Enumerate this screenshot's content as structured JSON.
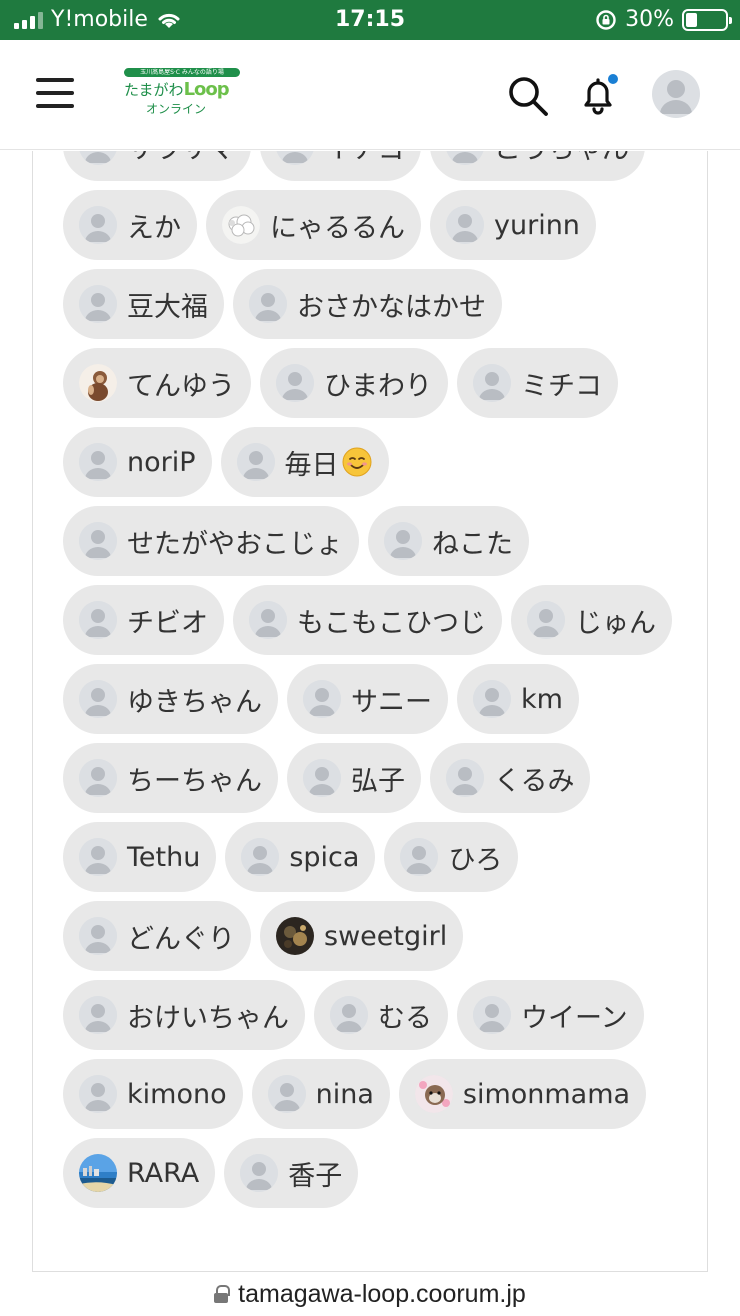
{
  "status_bar": {
    "carrier": "Y!mobile",
    "time": "17:15",
    "battery": "30%",
    "battery_level": 0.3
  },
  "header": {
    "logo": {
      "band": "玉川髙島屋S·C みんなの語り場",
      "main": "たまがわ",
      "loop": "Loop",
      "sub": "オンライン"
    }
  },
  "members": [
    {
      "name": "サラサマ",
      "avatar": "default"
    },
    {
      "name": "イチゴ",
      "avatar": "default"
    },
    {
      "name": "こうちゃん",
      "avatar": "default"
    },
    {
      "name": "えか",
      "avatar": "default"
    },
    {
      "name": "にゃるるん",
      "avatar": "sheep-photo"
    },
    {
      "name": "yurinn",
      "avatar": "default"
    },
    {
      "name": "豆大福",
      "avatar": "default"
    },
    {
      "name": "おさかなはかせ",
      "avatar": "default"
    },
    {
      "name": "てんゆう",
      "avatar": "monkey-photo"
    },
    {
      "name": "ひまわり",
      "avatar": "default"
    },
    {
      "name": "ミチコ",
      "avatar": "default"
    },
    {
      "name": "noriP",
      "avatar": "default"
    },
    {
      "name": "毎日",
      "avatar": "default",
      "emoji": "smiling-face-emoji"
    },
    {
      "name": "せたがやおこじょ",
      "avatar": "default"
    },
    {
      "name": "ねこた",
      "avatar": "default"
    },
    {
      "name": "チビオ",
      "avatar": "default"
    },
    {
      "name": "もこもこひつじ",
      "avatar": "default"
    },
    {
      "name": "じゅん",
      "avatar": "default"
    },
    {
      "name": "ゆきちゃん",
      "avatar": "default"
    },
    {
      "name": "サニー",
      "avatar": "default"
    },
    {
      "name": "km",
      "avatar": "default"
    },
    {
      "name": "ちーちゃん",
      "avatar": "default"
    },
    {
      "name": "弘子",
      "avatar": "default"
    },
    {
      "name": "くるみ",
      "avatar": "default"
    },
    {
      "name": "Tethu",
      "avatar": "default"
    },
    {
      "name": "spica",
      "avatar": "default"
    },
    {
      "name": "ひろ",
      "avatar": "default"
    },
    {
      "name": "どんぐり",
      "avatar": "default"
    },
    {
      "name": "sweetgirl",
      "avatar": "dark-photo"
    },
    {
      "name": "おけいちゃん",
      "avatar": "default"
    },
    {
      "name": "むる",
      "avatar": "default"
    },
    {
      "name": "ウイーン",
      "avatar": "default"
    },
    {
      "name": "kimono",
      "avatar": "default"
    },
    {
      "name": "nina",
      "avatar": "default"
    },
    {
      "name": "simonmama",
      "avatar": "dog-photo"
    },
    {
      "name": "RARA",
      "avatar": "beach-photo"
    },
    {
      "name": "香子",
      "avatar": "default"
    }
  ],
  "url_bar": {
    "url": "tamagawa-loop.coorum.jp"
  },
  "colors": {
    "status_bar_bg": "#1f7a3f",
    "chip_bg": "#e8e8e8",
    "notification_dot": "#1a7fd4",
    "brand_green": "#1f8f4a"
  }
}
